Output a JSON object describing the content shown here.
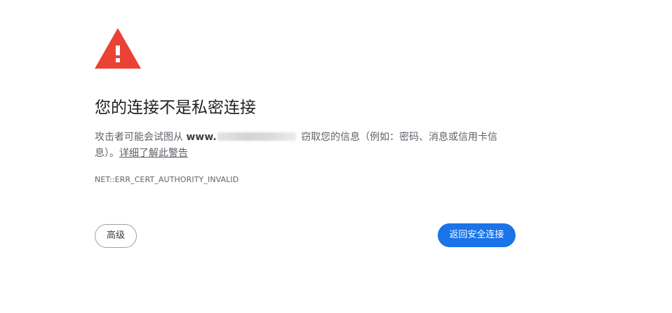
{
  "icon": "warning-triangle-icon",
  "colors": {
    "warning": "#ea4335",
    "primary_button": "#1a73e8",
    "text_primary": "#202124",
    "text_secondary": "#5f6368"
  },
  "title": "您的连接不是私密连接",
  "description": {
    "before_domain": "攻击者可能会试图从 ",
    "domain": "www.",
    "after_domain": " 窃取您的信息（例如：密码、消息或信用卡信息）。",
    "learn_more": "详细了解此警告"
  },
  "error_code": "NET::ERR_CERT_AUTHORITY_INVALID",
  "buttons": {
    "advanced": "高级",
    "back_to_safety": "返回安全连接"
  }
}
